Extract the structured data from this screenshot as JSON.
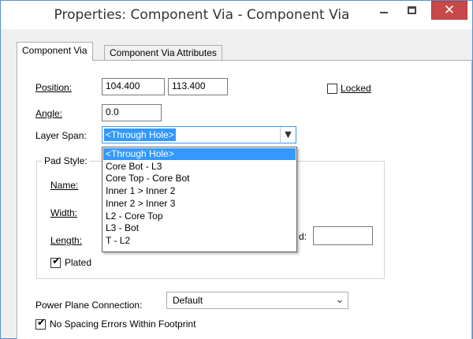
{
  "window": {
    "title": "Properties: Component Via - Component Via",
    "close_glyph": "✕"
  },
  "tabs": [
    {
      "label": "Component Via"
    },
    {
      "label": "Component Via Attributes"
    }
  ],
  "position": {
    "label": "Position:",
    "x": "104.400",
    "y": "113.400"
  },
  "locked": {
    "label": "Locked",
    "checked": false
  },
  "angle": {
    "label": "Angle:",
    "value": "0.0"
  },
  "layer_span": {
    "label": "Layer Span:",
    "selected": "<Through Hole>",
    "options": [
      "<Through Hole>",
      "Core Bot - L3",
      "Core Top - Core Bot",
      "Inner 1 > Inner 2",
      "Inner 2 > Inner 3",
      "L2 - Core Top",
      "L3 - Bot",
      "T - L2"
    ]
  },
  "pad_style": {
    "title": "Pad Style:",
    "name_label": "Name:",
    "width_label": "Width:",
    "length_label": "Length:",
    "partial_label": "d:",
    "plated_label": "Plated",
    "plated_checked": true
  },
  "power_plane": {
    "label": "Power Plane Connection:",
    "value": "Default"
  },
  "no_spacing": {
    "label": "No Spacing Errors Within Footprint",
    "checked": true
  },
  "icons": {
    "check": "✔",
    "chevron": "⌄"
  }
}
